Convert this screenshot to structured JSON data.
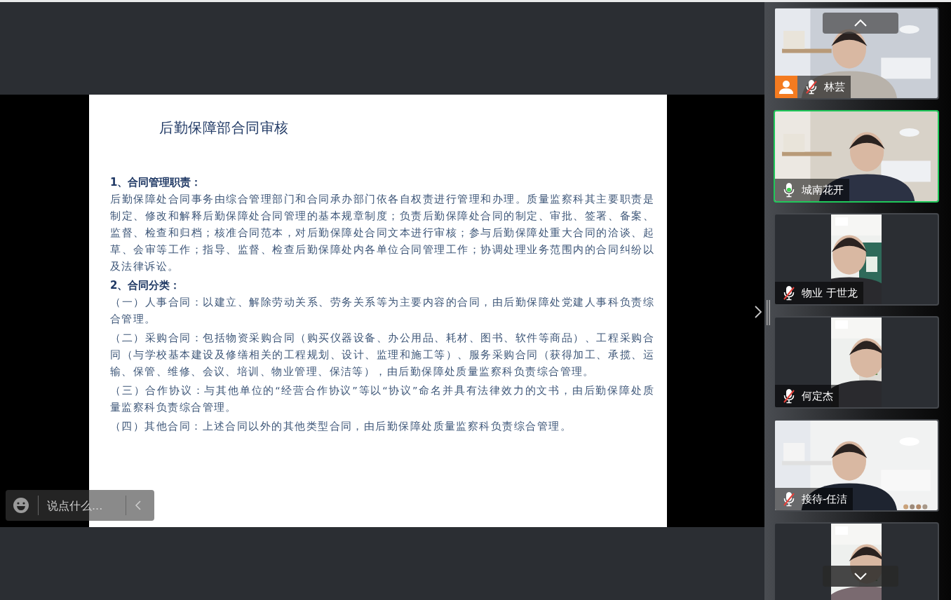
{
  "slide": {
    "title": "后勤保障部合同审核",
    "sections": [
      {
        "heading": "1、合同管理职责：",
        "paragraphs": [
          "后勤保障处合同事务由综合管理部门和合同承办部门依各自权责进行管理和办理。质量监察科其主要职责是制定、修改和解释后勤保障处合同管理的基本规章制度；负责后勤保障处合同的制定、审批、签署、备案、监督、检查和归档；核准合同范本，对后勤保障处合同文本进行审核；参与后勤保障处重大合同的洽谈、起草、会审等工作；指导、监督、检查后勤保障处内各单位合同管理工作；协调处理业务范围内的合同纠纷以及法律诉讼。"
        ]
      },
      {
        "heading": "2、合同分类：",
        "paragraphs": [
          "（一）人事合同：以建立、解除劳动关系、劳务关系等为主要内容的合同，由后勤保障处党建人事科负责综合管理。",
          "（二）采购合同：包括物资采购合同（购买仪器设备、办公用品、耗材、图书、软件等商品）、工程采购合同（与学校基本建设及修缮相关的工程规划、设计、监理和施工等）、服务采购合同（获得加工、承揽、运输、保管、维修、会议、培训、物业管理、保洁等），由后勤保障处质量监察科负责综合管理。",
          "（三）合作协议：与其他单位的“经营合作协议”等以“协议”命名并具有法律效力的文书，由后勤保障处质量监察科负责综合管理。",
          "（四）其他合同：上述合同以外的其他类型合同，由后勤保障处质量监察科负责综合管理。"
        ]
      }
    ]
  },
  "chat": {
    "placeholder": "说点什么..."
  },
  "participants": [
    {
      "name": "林芸",
      "muted": true,
      "speaking": false,
      "avatar_badge": true,
      "kind": "wide"
    },
    {
      "name": "城南花开",
      "muted": false,
      "speaking": true,
      "avatar_badge": false,
      "kind": "wide"
    },
    {
      "name": "物业 于世龙",
      "muted": true,
      "speaking": false,
      "avatar_badge": false,
      "kind": "portrait"
    },
    {
      "name": "何定杰",
      "muted": true,
      "speaking": false,
      "avatar_badge": false,
      "kind": "portrait"
    },
    {
      "name": "接待-任洁",
      "muted": true,
      "speaking": false,
      "avatar_badge": false,
      "kind": "wide"
    },
    {
      "speaking": false,
      "kind": "portrait"
    }
  ]
}
